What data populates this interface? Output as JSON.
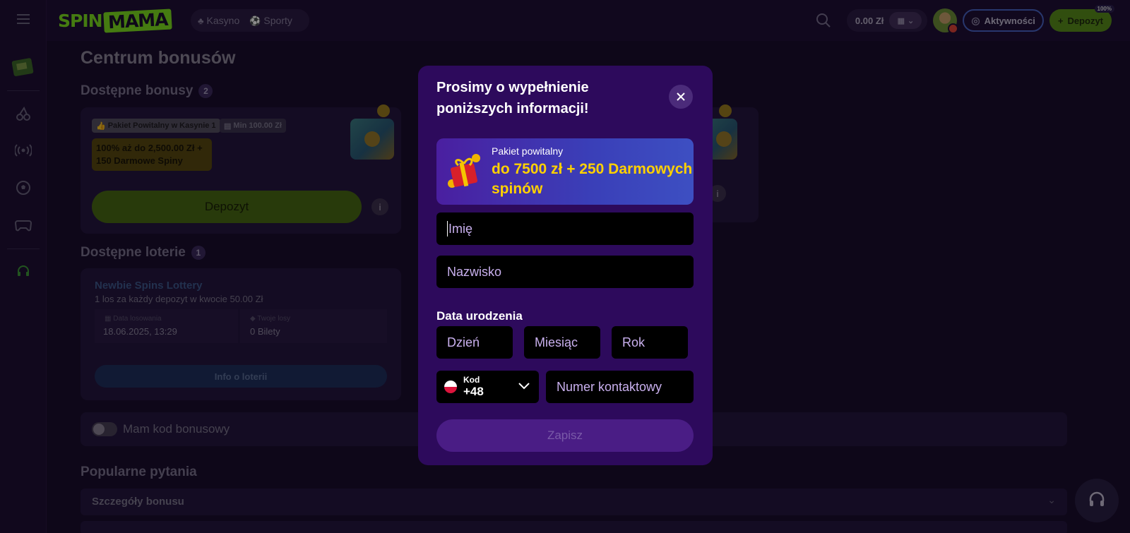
{
  "topbar": {
    "logo_part1": "SPIN",
    "logo_part2": "MAMA",
    "nav": [
      "Kasyno",
      "Sporty"
    ],
    "balance": "0.00 Zł",
    "activity_label": "Aktywności",
    "deposit_label": "Depozyt",
    "deposit_badge": "100%"
  },
  "page": {
    "title": "Centrum bonusów",
    "bonuses_heading": "Dostępne bonusy",
    "bonuses_count": "2",
    "bonus_card": {
      "tag1": "Pakiet Powitalny w Kasynie 1",
      "tag2": "Min 100.00 Zł",
      "offer": "100% aż do 2,500.00 Zł + 150 Darmowe Spiny",
      "button": "Depozyt"
    },
    "lotteries_heading": "Dostępne loterie",
    "lotteries_count": "1",
    "lottery": {
      "title": "Newbie Spins Lottery",
      "subtitle": "1 los za każdy depozyt w kwocie 50.00 Zł",
      "date_label": "Data losowania",
      "date_value": "18.06.2025, 13:29",
      "tickets_label": "Twoje losy",
      "tickets_value": "0 Bilety",
      "button": "Info o loterii"
    },
    "bonus_code_label": "Mam kod bonusowy",
    "faq_heading": "Popularne pytania",
    "faq_item": "Szczegóły bonusu"
  },
  "modal": {
    "title": "Prosimy o wypełnienie poniższych informacji!",
    "promo_small": "Pakiet powitalny",
    "promo_big": "do 7500 zł + 250 Darmowych spinów",
    "first_name_placeholder": "Imię",
    "last_name_placeholder": "Nazwisko",
    "birth_label": "Data urodzenia",
    "day_placeholder": "Dzień",
    "month_placeholder": "Miesiąc",
    "year_placeholder": "Rok",
    "code_label": "Kod",
    "code_value": "+48",
    "phone_placeholder": "Numer kontaktowy",
    "save_button": "Zapisz"
  }
}
